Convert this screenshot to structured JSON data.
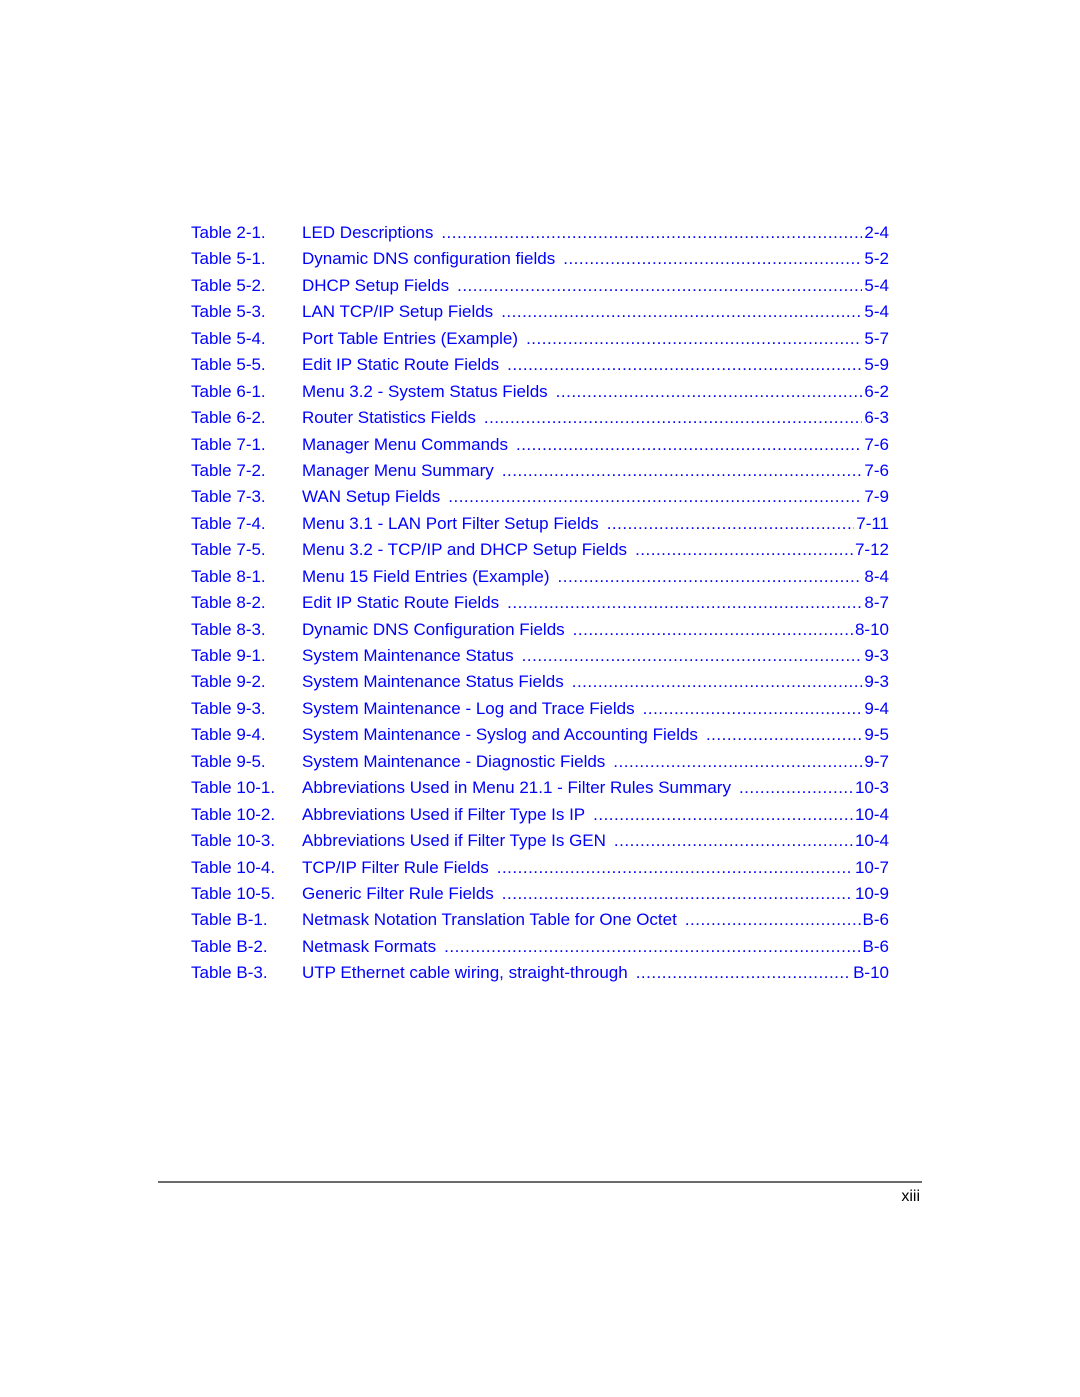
{
  "entries": [
    {
      "label": "Table 2-1.",
      "title": "LED Descriptions",
      "page": "2-4"
    },
    {
      "label": "Table 5-1.",
      "title": "Dynamic DNS configuration fields",
      "page": "5-2"
    },
    {
      "label": "Table 5-2.",
      "title": "DHCP Setup Fields",
      "page": "5-4"
    },
    {
      "label": "Table 5-3.",
      "title": "LAN TCP/IP Setup Fields",
      "page": "5-4"
    },
    {
      "label": "Table 5-4.",
      "title": "Port Table Entries (Example)",
      "page": "5-7"
    },
    {
      "label": "Table 5-5.",
      "title": "Edit IP Static Route Fields",
      "page": "5-9"
    },
    {
      "label": "Table 6-1.",
      "title": "Menu 3.2 - System Status Fields",
      "page": "6-2"
    },
    {
      "label": "Table 6-2.",
      "title": "Router Statistics Fields",
      "page": "6-3"
    },
    {
      "label": "Table 7-1.",
      "title": "Manager Menu Commands",
      "page": "7-6"
    },
    {
      "label": "Table 7-2.",
      "title": "Manager Menu Summary",
      "page": "7-6"
    },
    {
      "label": "Table 7-3.",
      "title": "WAN Setup Fields",
      "page": "7-9"
    },
    {
      "label": "Table 7-4.",
      "title": "Menu 3.1 - LAN Port Filter Setup Fields",
      "page": "7-11"
    },
    {
      "label": "Table 7-5.",
      "title": "Menu 3.2 - TCP/IP and DHCP Setup Fields",
      "page": "7-12"
    },
    {
      "label": "Table 8-1.",
      "title": "Menu 15 Field Entries (Example)",
      "page": "8-4"
    },
    {
      "label": "Table 8-2.",
      "title": "Edit IP Static Route Fields",
      "page": "8-7"
    },
    {
      "label": "Table 8-3.",
      "title": "Dynamic DNS Configuration Fields",
      "page": "8-10"
    },
    {
      "label": "Table 9-1.",
      "title": "System Maintenance Status",
      "page": "9-3"
    },
    {
      "label": "Table 9-2.",
      "title": "System Maintenance Status Fields",
      "page": "9-3"
    },
    {
      "label": "Table 9-3.",
      "title": "System Maintenance - Log and Trace Fields",
      "page": "9-4"
    },
    {
      "label": "Table 9-4.",
      "title": "System Maintenance - Syslog and Accounting Fields",
      "page": "9-5"
    },
    {
      "label": "Table 9-5.",
      "title": "System Maintenance - Diagnostic Fields",
      "page": "9-7"
    },
    {
      "label": "Table 10-1.",
      "title": "Abbreviations Used in Menu 21.1 - Filter Rules Summary",
      "page": "10-3"
    },
    {
      "label": "Table 10-2.",
      "title": "Abbreviations Used if Filter Type Is IP",
      "page": "10-4"
    },
    {
      "label": "Table 10-3.",
      "title": "Abbreviations Used if Filter Type Is GEN",
      "page": "10-4"
    },
    {
      "label": "Table 10-4.",
      "title": "TCP/IP Filter Rule Fields",
      "page": "10-7"
    },
    {
      "label": "Table 10-5.",
      "title": "Generic Filter Rule Fields",
      "page": "10-9"
    },
    {
      "label": "Table B-1.",
      "title": "Netmask Notation Translation Table for One Octet",
      "page": "B-6"
    },
    {
      "label": "Table B-2.",
      "title": "Netmask Formats",
      "page": "B-6"
    },
    {
      "label": "Table B-3.",
      "title": "UTP Ethernet cable wiring, straight-through",
      "page": "B-10"
    }
  ],
  "footer": {
    "page_number": "xiii"
  }
}
